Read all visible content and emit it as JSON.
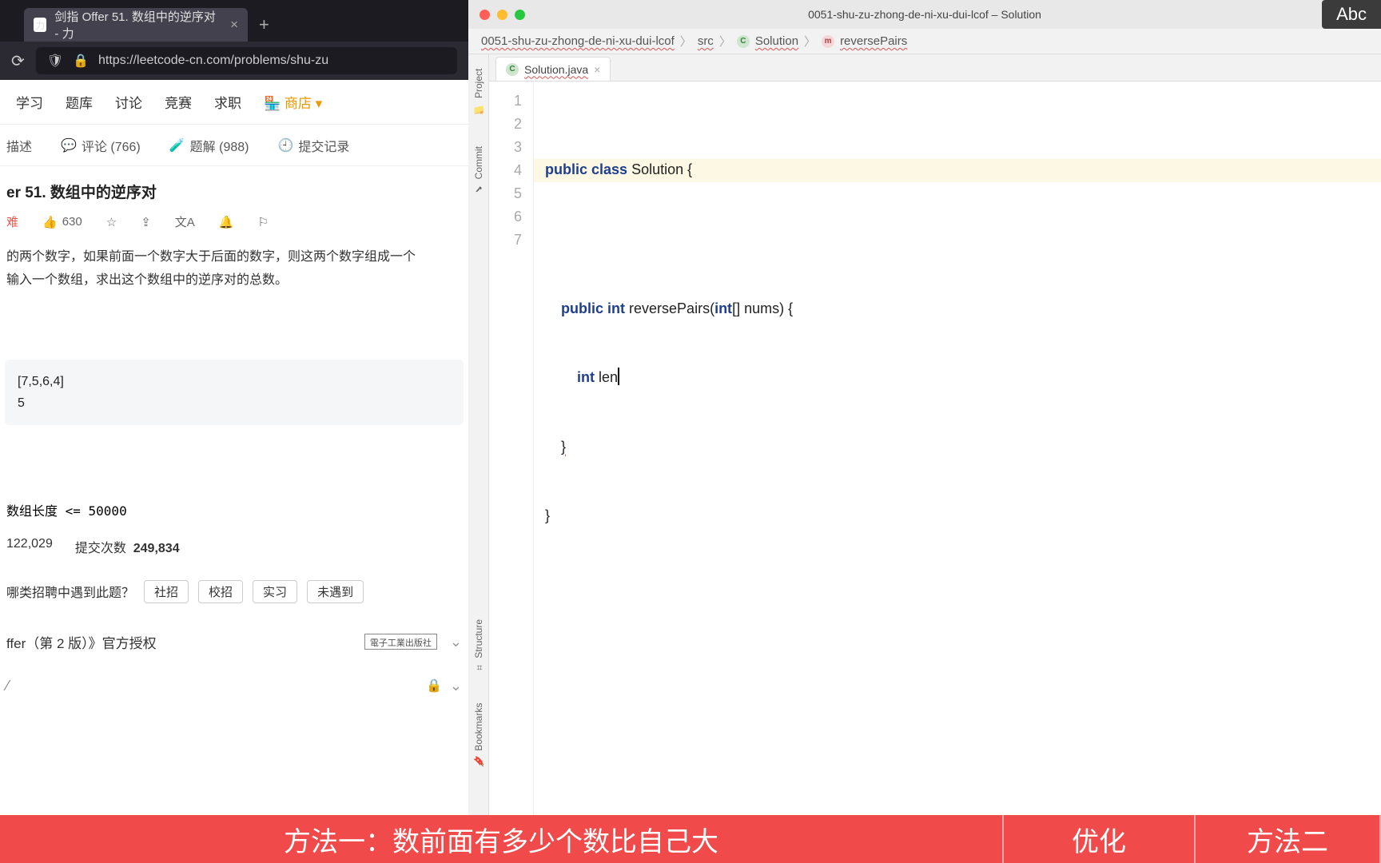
{
  "browser": {
    "tab_title": "剑指 Offer 51. 数组中的逆序对 - 力",
    "url_display": "https://leetcode-cn.com/problems/shu-zu",
    "nav": {
      "learn": "学习",
      "problems": "题库",
      "discuss": "讨论",
      "contest": "竞赛",
      "jobs": "求职",
      "shop": "商店"
    },
    "tabs": {
      "desc": "描述",
      "comments": "评论 (766)",
      "solutions": "题解 (988)",
      "history": "提交记录"
    },
    "problem_title": "er 51. 数组中的逆序对",
    "likes": "630",
    "desc_line1": "的两个数字，如果前面一个数字大于后面的数字，则这两个数字组成一个",
    "desc_line2": "输入一个数组，求出这个数组中的逆序对的总数。",
    "example_in": "[7,5,6,4]",
    "example_out": "5",
    "limit": "数组长度 <= 50000",
    "pass_count": "122,029",
    "submit_label": "提交次数",
    "submit_count": "249,834",
    "company_q": "哪类招聘中遇到此题？",
    "chips": {
      "c1": "社招",
      "c2": "校招",
      "c3": "实习",
      "c4": "未遇到"
    },
    "auth": "ffer（第 2 版）》官方授权",
    "publisher": "電子工業出版社"
  },
  "ide": {
    "window_title": "0051-shu-zu-zhong-de-ni-xu-dui-lcof – Solution",
    "abc": "Abc",
    "crumbs": {
      "p1": "0051-shu-zu-zhong-de-ni-xu-dui-lcof",
      "p2": "src",
      "p3": "Solution",
      "p4": "reversePairs"
    },
    "tab": "Solution.java",
    "sidebar": {
      "project": "Project",
      "commit": "Commit",
      "structure": "Structure",
      "bookmarks": "Bookmarks"
    },
    "code": {
      "l1a": "public",
      "l1b": "class",
      "l1c": " Solution {",
      "l3a": "public",
      "l3b": "int",
      "l3c": " reversePairs(",
      "l3d": "int",
      "l3e": "[] nums) {",
      "l4a": "int",
      "l4b": " len",
      "l5": "}",
      "l6": "}"
    }
  },
  "strip": {
    "c1": "方法一：数前面有多少个数比自己大",
    "c2": "优化",
    "c3": "方法二"
  }
}
